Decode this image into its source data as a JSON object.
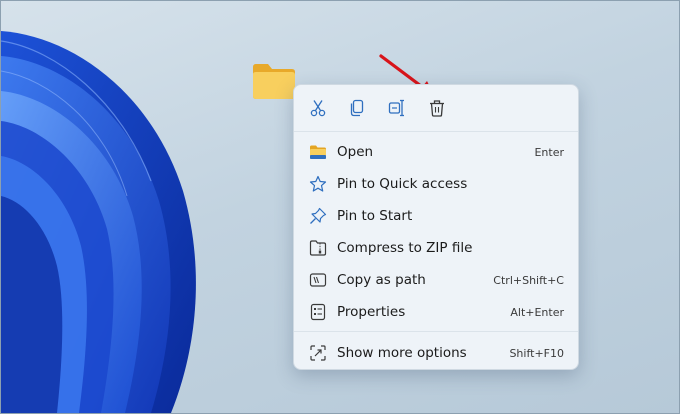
{
  "toolbar": {
    "buttons": [
      {
        "name": "cut",
        "icon": "scissors-icon"
      },
      {
        "name": "copy",
        "icon": "copy-icon"
      },
      {
        "name": "rename",
        "icon": "rename-icon"
      },
      {
        "name": "delete",
        "icon": "trash-icon"
      }
    ]
  },
  "menu": {
    "items": [
      {
        "label": "Open",
        "shortcut": "Enter",
        "icon": "folder-icon"
      },
      {
        "label": "Pin to Quick access",
        "shortcut": "",
        "icon": "star-icon"
      },
      {
        "label": "Pin to Start",
        "shortcut": "",
        "icon": "pin-icon"
      },
      {
        "label": "Compress to ZIP file",
        "shortcut": "",
        "icon": "zip-icon"
      },
      {
        "label": "Copy as path",
        "shortcut": "Ctrl+Shift+C",
        "icon": "path-icon"
      },
      {
        "label": "Properties",
        "shortcut": "Alt+Enter",
        "icon": "properties-icon"
      }
    ],
    "more": {
      "label": "Show more options",
      "shortcut": "Shift+F10",
      "icon": "expand-icon"
    }
  },
  "colors": {
    "accent": "#2f6fbf",
    "annotation_arrow": "#d8141a",
    "folder": "#f6c54a"
  }
}
